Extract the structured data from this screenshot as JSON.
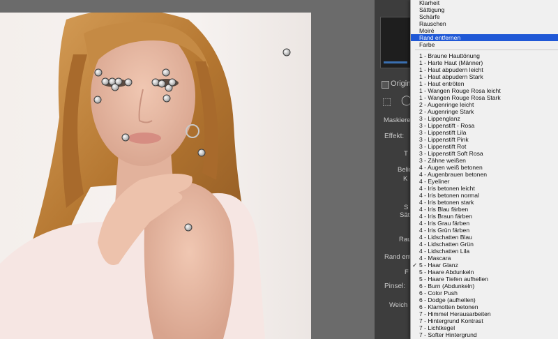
{
  "panel": {
    "origin_label": "Origin",
    "mask_label": "Maskiere",
    "effect_label": "Effekt:",
    "row_labels": [
      "T",
      "Belic",
      "K",
      "S",
      "Sät",
      "Rau",
      "Rand ent",
      "F",
      "Pinsel:",
      "Weich"
    ]
  },
  "menu": {
    "top_items": [
      "Klarheit",
      "Sättigung",
      "Schärfe",
      "Rauschen",
      "Moiré",
      "Rand entfernen",
      "Farbe"
    ],
    "selected_index": 5,
    "presets": [
      "1 - Braune Hauttönung",
      "1 - Harte Haut (Männer)",
      "1 - Haut abpudern leicht",
      "1 - Haut abpudern Stark",
      "1 - Haut entröten",
      "1 - Wangen Rouge Rosa leicht",
      "1 - Wangen Rouge Rosa Stark",
      "2 - Augenringe leicht",
      "2 - Augenringe Stark",
      "3 - Lippenglanz",
      "3 - Lippenstift - Rosa",
      "3 - Lippenstift Lila",
      "3 - Lippenstift Pink",
      "3 - Lippenstift Rot",
      "3 - Lippenstift Soft Rosa",
      "3 - Zähne weißen",
      "4 - Augen weiß betonen",
      "4 - Augenbrauen betonen",
      "4 - Eyeliner",
      "4 - Iris betonen leicht",
      "4 - Iris betonen normal",
      "4 - Iris betonen stark",
      "4 - Iris Blau färben",
      "4 - Iris Braun färben",
      "4 - Iris Grau färben",
      "4 - Iris Grün färben",
      "4 - Lidschatten Blau",
      "4 - Lidschatten Grün",
      "4 - Lidschatten Lila",
      "4 - Mascara",
      "5 - Haar Glanz",
      "5 - Haare Abdunkeln",
      "5 - Haare Tiefen aufhellen",
      "6 - Burn (Abdunkeln)",
      "6 - Color Push",
      "6 - Dodge (aufhellen)",
      "6 - Klamotten betonen",
      "7 - Himmel Herausarbeiten",
      "7 - Hintergrund Kontrast",
      "7 - Lichtkegel",
      "7 - Softer Hintergrund"
    ],
    "checked_preset_index": 30,
    "checkmark": "✓"
  },
  "colors": {
    "selection": "#1f58d6",
    "menu_bg": "#f0f0f0",
    "panel_bg": "#3d3d3d"
  },
  "pins_count_label": ""
}
